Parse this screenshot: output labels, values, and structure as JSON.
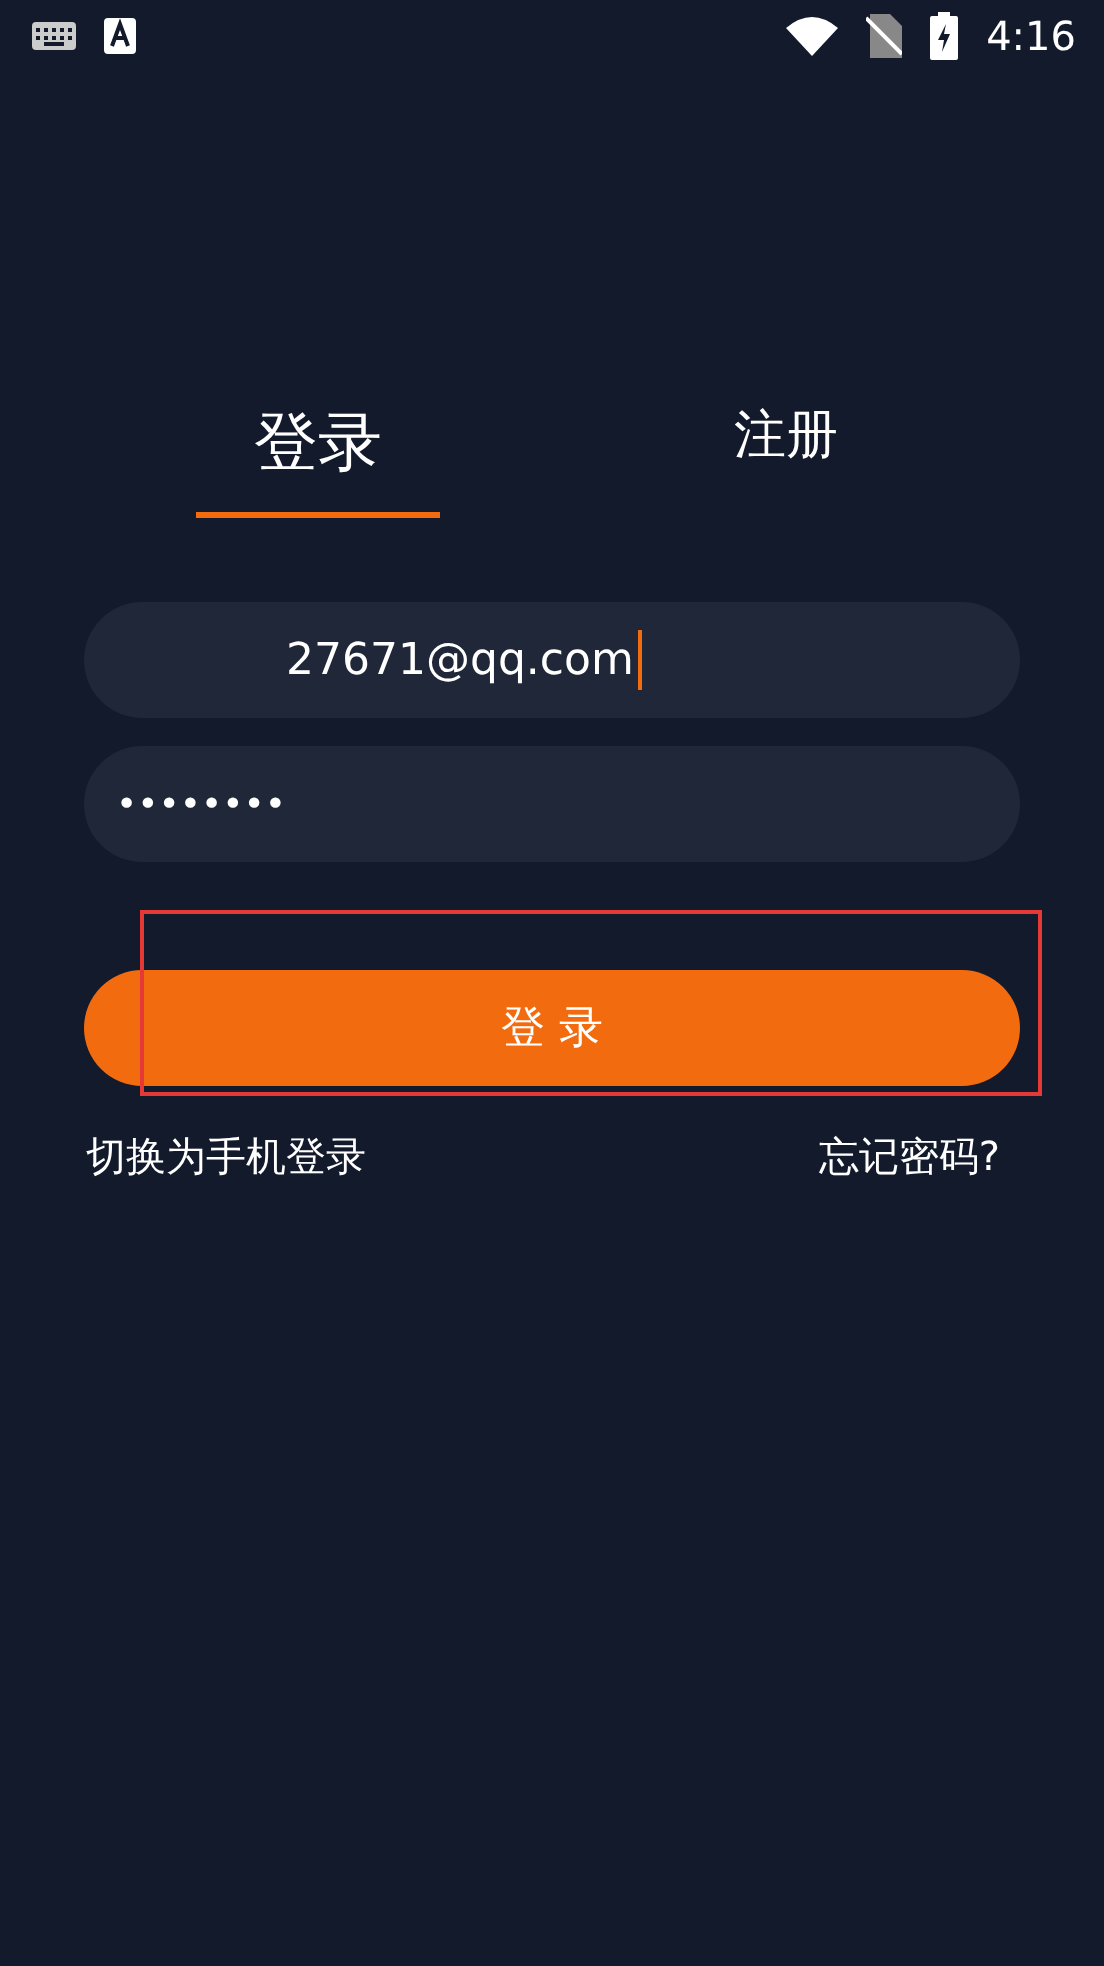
{
  "status_bar": {
    "time": "4:16"
  },
  "tabs": [
    {
      "label": "登录",
      "selected": true
    },
    {
      "label": "注册",
      "selected": false
    }
  ],
  "fields": [
    {
      "kind": "email",
      "value": "27671@qq.com",
      "focused": true
    },
    {
      "kind": "password",
      "value": "••••••••",
      "focused": false
    }
  ],
  "login_button": {
    "label": "登 录",
    "highlighted": true
  },
  "links": [
    "切换为手机登录",
    "忘记密码?"
  ]
}
